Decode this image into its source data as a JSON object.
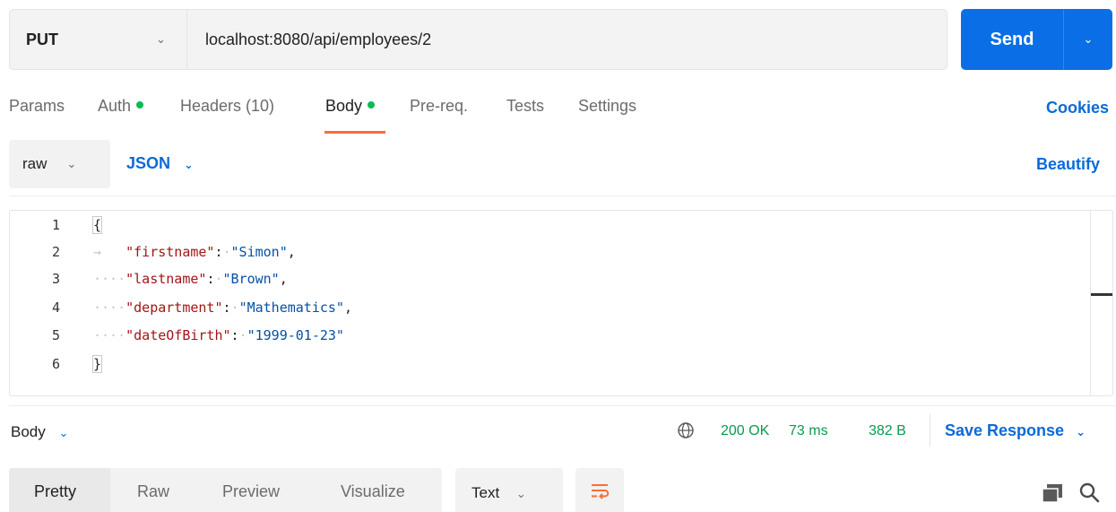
{
  "request": {
    "method": "PUT",
    "url": "localhost:8080/api/employees/2",
    "send_label": "Send"
  },
  "tabs": {
    "params": "Params",
    "auth": "Auth",
    "headers": "Headers (10)",
    "body": "Body",
    "prereq": "Pre-req.",
    "tests": "Tests",
    "settings": "Settings",
    "cookies": "Cookies",
    "active": "Body",
    "dot_color": "#0cbb52",
    "underline_color": "#ff6c37"
  },
  "body_options": {
    "mode": "raw",
    "language": "JSON",
    "beautify": "Beautify"
  },
  "editor": {
    "line_numbers": [
      "1",
      "2",
      "3",
      "4",
      "5",
      "6"
    ],
    "open_brace": "{",
    "close_brace": "}",
    "fields": [
      {
        "key": "\"firstname\"",
        "value": "\"Simon\""
      },
      {
        "key": "\"lastname\"",
        "value": "\"Brown\""
      },
      {
        "key": "\"department\"",
        "value": "\"Mathematics\""
      },
      {
        "key": "\"dateOfBirth\"",
        "value": "\"1999-01-23\""
      }
    ],
    "key_color": "#a31515",
    "value_color": "#0451a5"
  },
  "response": {
    "section_label": "Body",
    "status": "200 OK",
    "time": "73 ms",
    "size": "382 B",
    "save_response": "Save Response",
    "status_color": "#0a9a4e",
    "view_tabs": [
      "Pretty",
      "Raw",
      "Preview",
      "Visualize"
    ],
    "active_view": "Pretty",
    "format": "Text"
  },
  "icons": {
    "method_dropdown": "chevron-down-icon",
    "send_dropdown": "chevron-down-icon",
    "globe": "globe-icon",
    "wrap": "wrap-lines-icon",
    "copy": "copy-icon",
    "search": "search-icon"
  },
  "accent_color": "#0a6fe6"
}
